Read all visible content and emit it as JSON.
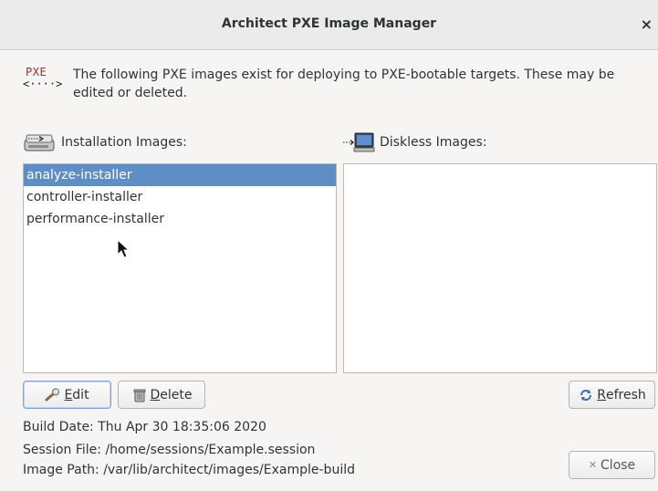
{
  "window": {
    "title": "Architect PXE Image Manager",
    "close_glyph": "×"
  },
  "intro": {
    "icon_label": "PXE",
    "icon_arrows": "<····>",
    "text": "The following PXE images exist for deploying to PXE-bootable targets.  These may be edited or deleted."
  },
  "installation": {
    "label": "Installation Images:",
    "icon": "drive-icon",
    "items": [
      {
        "label": "analyze-installer",
        "selected": true
      },
      {
        "label": "controller-installer",
        "selected": false
      },
      {
        "label": "performance-installer",
        "selected": false
      }
    ]
  },
  "diskless": {
    "label": "Diskless Images:",
    "icon": "monitor-icon",
    "items": []
  },
  "buttons": {
    "edit_mnemonic": "E",
    "edit_rest": "dit",
    "delete_mnemonic": "D",
    "delete_rest": "elete",
    "refresh_mnemonic": "R",
    "refresh_rest": "efresh",
    "close_label": "Close",
    "close_glyph": "✕"
  },
  "info": {
    "build_date": "Build Date:  Thu Apr 30 18:35:06 2020",
    "session_file": "Session File:  /home/sessions/Example.session",
    "image_path": "Image Path:  /var/lib/architect/images/Example-build"
  },
  "colors": {
    "selection": "#5e8ec5",
    "window_bg": "#f6f5f4",
    "titlebar_bg": "#ebebeb"
  }
}
